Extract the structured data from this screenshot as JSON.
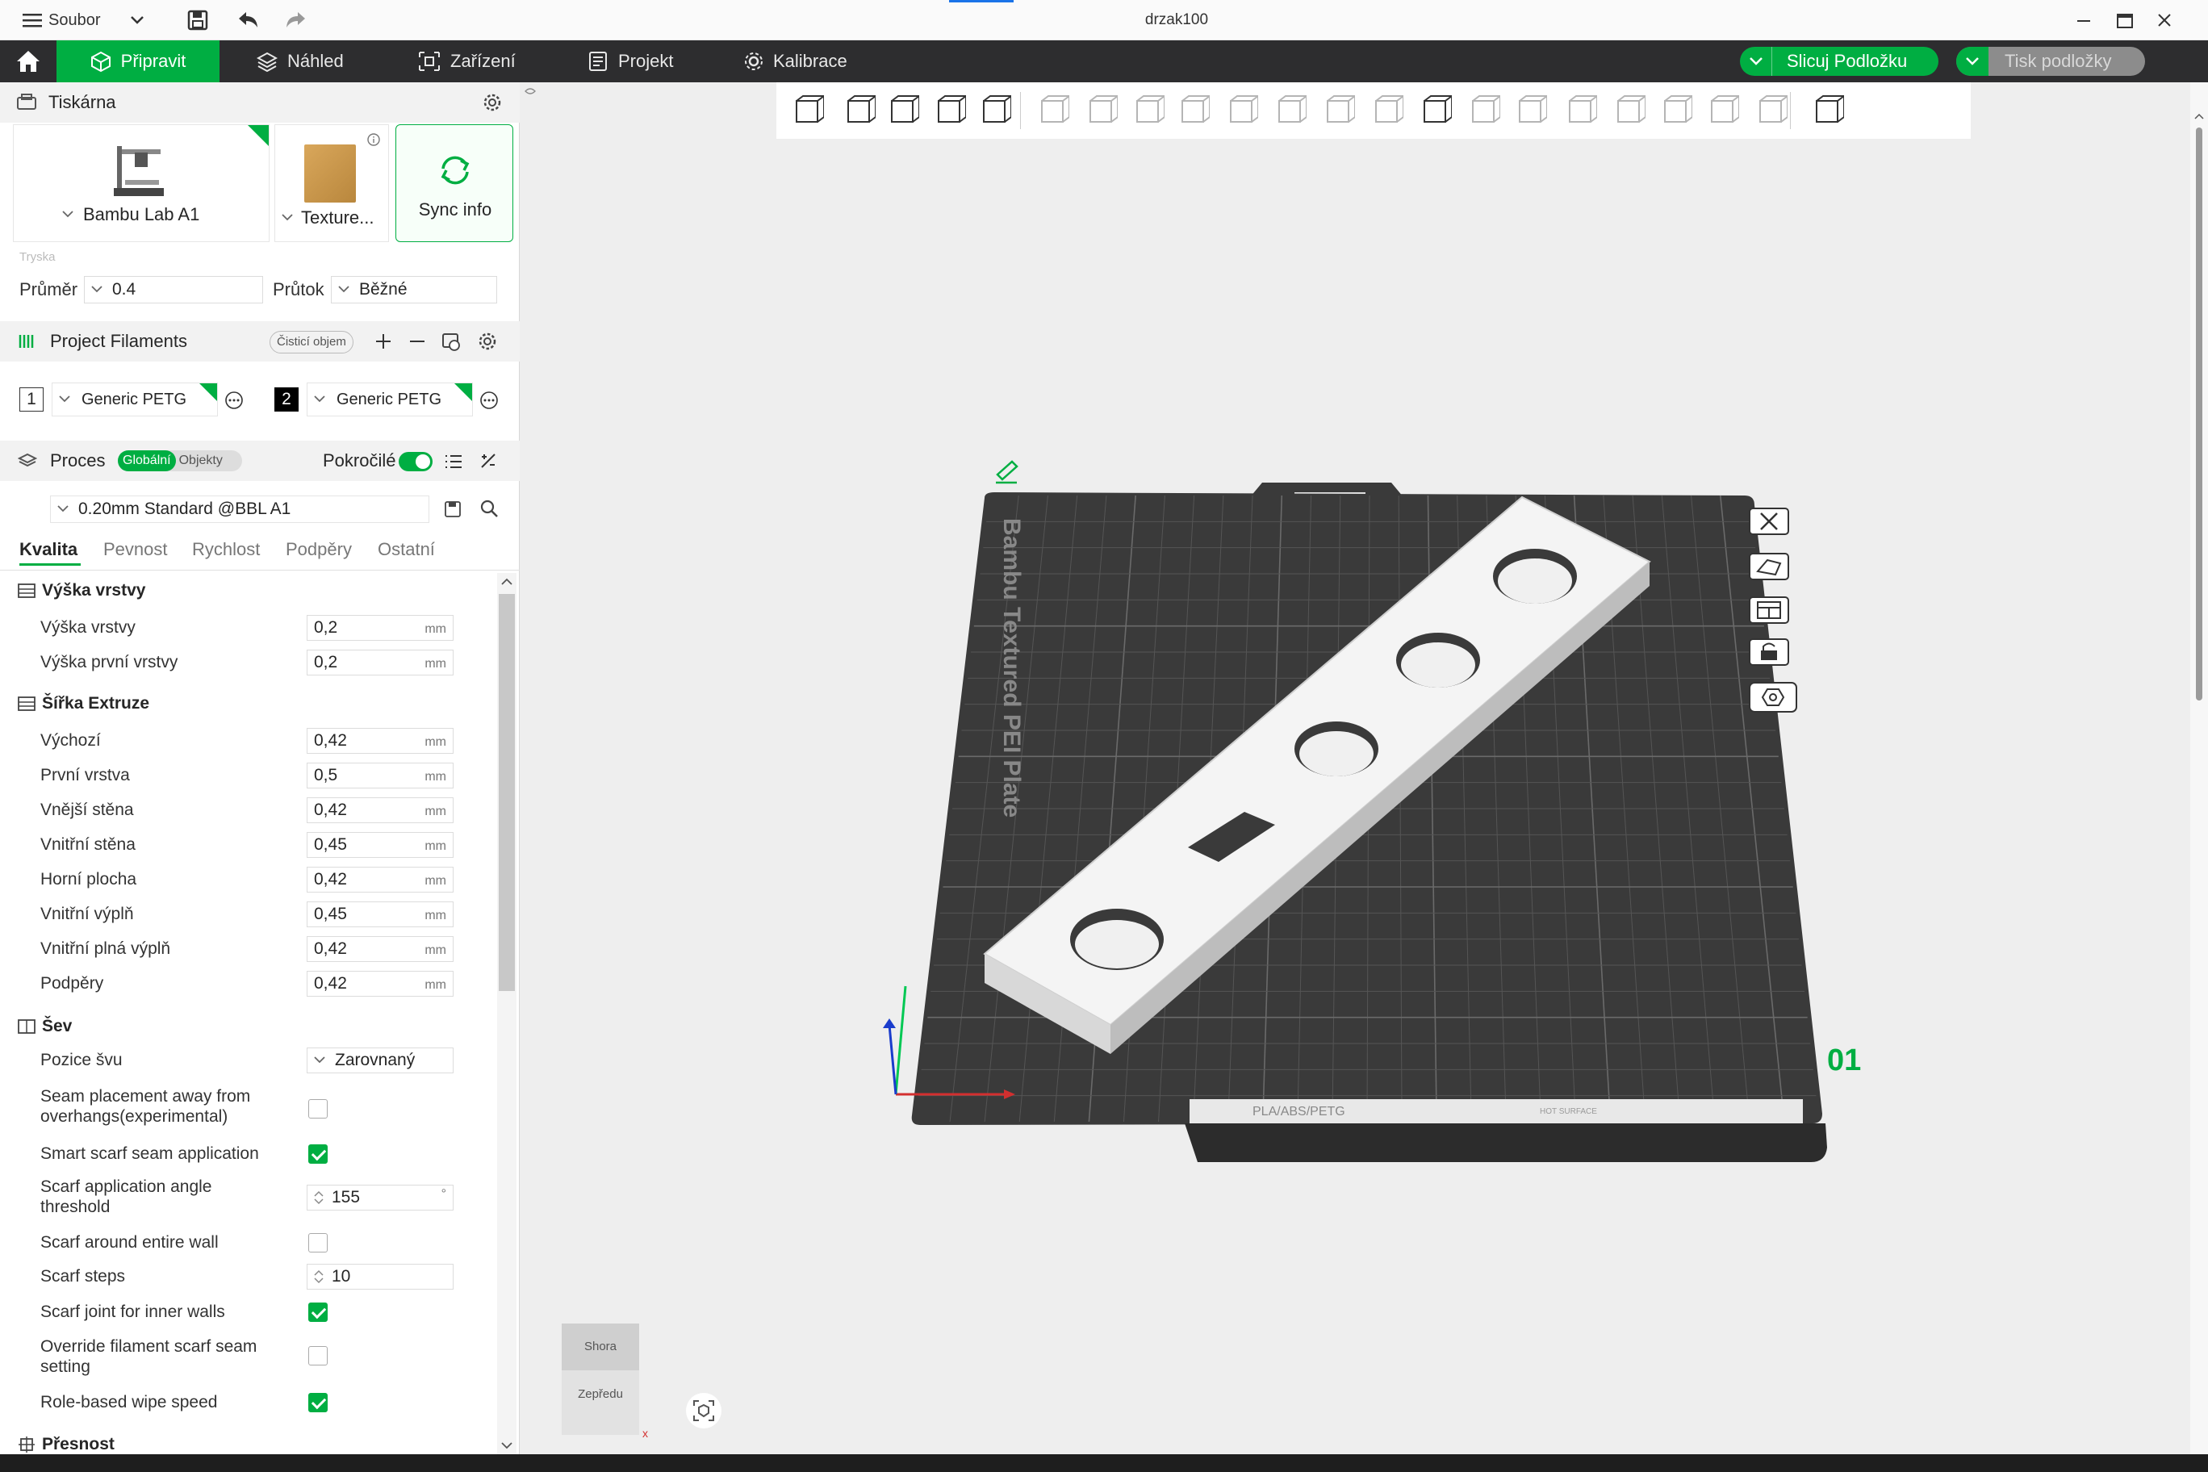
{
  "titlebar": {
    "menu_label": "Soubor",
    "doc_title": "drzak100"
  },
  "nav": {
    "tabs": [
      {
        "label": "Připravit",
        "active": true
      },
      {
        "label": "Náhled"
      },
      {
        "label": "Zařízení"
      },
      {
        "label": "Projekt"
      },
      {
        "label": "Kalibrace"
      }
    ],
    "slice_button": "Slicuj Podložku",
    "print_button": "Tisk podložky",
    "accent": "#00ae42"
  },
  "printer": {
    "section_title": "Tiskárna",
    "printer_name": "Bambu Lab A1",
    "plate_name": "Texture...",
    "sync_label": "Sync info",
    "nozzle_caption": "Tryska",
    "diameter_label": "Průměr",
    "diameter_value": "0.4",
    "flow_label": "Průtok",
    "flow_value": "Běžné"
  },
  "filaments": {
    "section_title": "Project Filaments",
    "purge_label": "Čisticí objem",
    "items": [
      {
        "index": "1",
        "name": "Generic PETG"
      },
      {
        "index": "2",
        "name": "Generic PETG"
      }
    ]
  },
  "process": {
    "section_title": "Proces",
    "toggle_global": "Globální",
    "toggle_objects": "Objekty",
    "advanced_label": "Pokročilé",
    "preset": "0.20mm Standard @BBL A1",
    "tabs": [
      "Kvalita",
      "Pevnost",
      "Rychlost",
      "Podpěry",
      "Ostatní"
    ]
  },
  "quality": {
    "layer_group": "Výška vrstvy",
    "layer_rows": [
      {
        "label": "Výška vrstvy",
        "value": "0,2",
        "unit": "mm"
      },
      {
        "label": "Výška první vrstvy",
        "value": "0,2",
        "unit": "mm"
      }
    ],
    "width_group": "Šířka Extruze",
    "width_rows": [
      {
        "label": "Výchozí",
        "value": "0,42",
        "unit": "mm"
      },
      {
        "label": "První vrstva",
        "value": "0,5",
        "unit": "mm"
      },
      {
        "label": "Vnější stěna",
        "value": "0,42",
        "unit": "mm"
      },
      {
        "label": "Vnitřní stěna",
        "value": "0,45",
        "unit": "mm"
      },
      {
        "label": "Horní plocha",
        "value": "0,42",
        "unit": "mm"
      },
      {
        "label": "Vnitřní výplň",
        "value": "0,45",
        "unit": "mm"
      },
      {
        "label": "Vnitřní plná výplň",
        "value": "0,42",
        "unit": "mm"
      },
      {
        "label": "Podpěry",
        "value": "0,42",
        "unit": "mm"
      }
    ],
    "seam_group": "Šev",
    "seam_position_label": "Pozice švu",
    "seam_position_value": "Zarovnaný",
    "seam_away_label": "Seam placement away from overhangs(experimental)",
    "smart_scarf_label": "Smart scarf seam application",
    "scarf_angle_label": "Scarf application angle threshold",
    "scarf_angle_value": "155",
    "scarf_angle_unit": "°",
    "scarf_entire_label": "Scarf around entire wall",
    "scarf_steps_label": "Scarf steps",
    "scarf_steps_value": "10",
    "scarf_inner_label": "Scarf joint for inner walls",
    "override_label": "Override filament scarf seam setting",
    "wipe_label": "Role-based wipe speed",
    "precision_group": "Přesnost",
    "checks": {
      "seam_away": false,
      "smart_scarf": true,
      "scarf_entire": false,
      "scarf_inner": true,
      "override": false,
      "wipe": true
    }
  },
  "viewport": {
    "plate_text": "Bambu Textured PEI Plate",
    "plate_number": "01",
    "plate_material": "PLA/ABS/PETG",
    "plate_surface": "HOT SURFACE",
    "cube_top": "Shora",
    "cube_front": "Zepředu",
    "axis_x": "x"
  }
}
